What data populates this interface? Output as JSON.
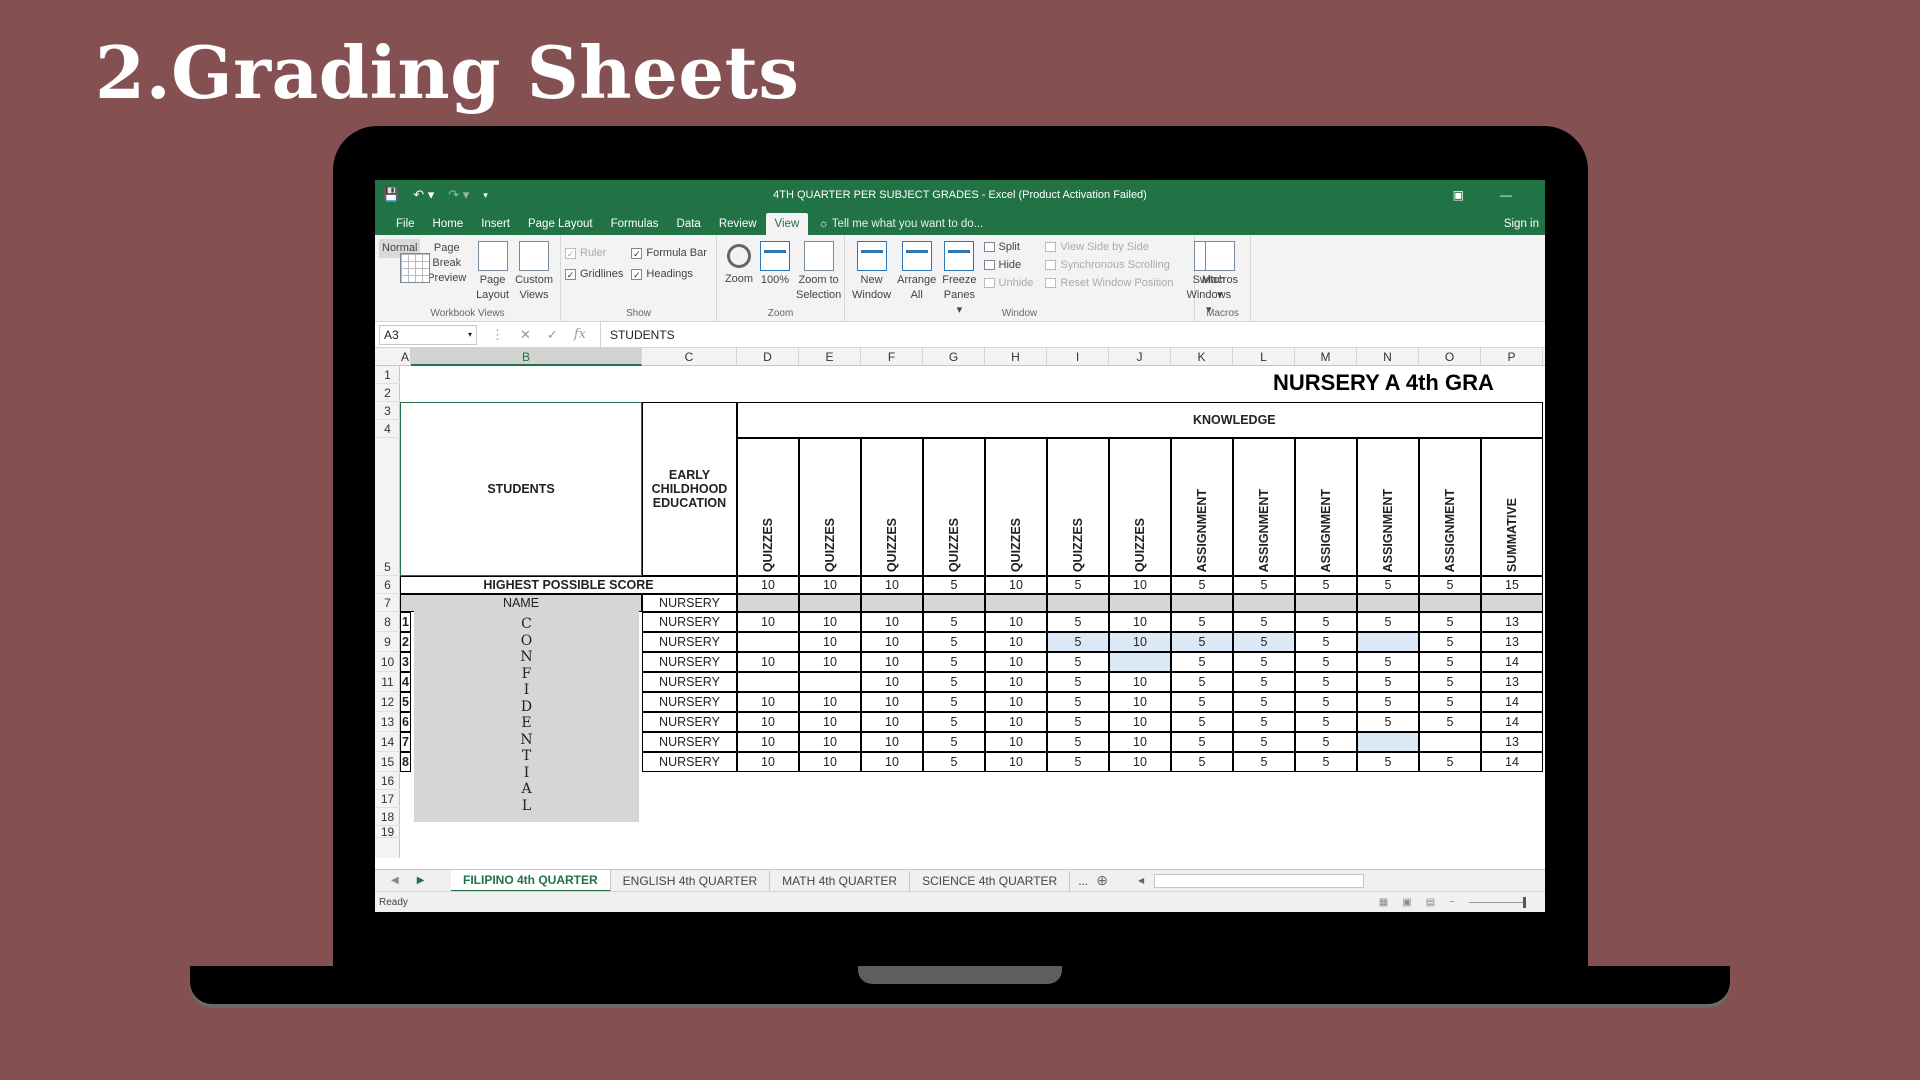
{
  "slide_title": "2.Grading Sheets",
  "excel": {
    "window_title": "4TH QUARTER PER SUBJECT GRADES - Excel (Product Activation Failed)",
    "menu_tabs": [
      "File",
      "Home",
      "Insert",
      "Page Layout",
      "Formulas",
      "Data",
      "Review",
      "View"
    ],
    "active_menu_tab": "View",
    "tell_me": "Tell me what you want to do...",
    "sign_in": "Sign in",
    "ribbon": {
      "workbook_views": {
        "label": "Workbook Views",
        "buttons": [
          [
            "Normal",
            ""
          ],
          [
            "Page Break",
            "Preview"
          ],
          [
            "Page",
            "Layout"
          ],
          [
            "Custom",
            "Views"
          ]
        ]
      },
      "show": {
        "label": "Show",
        "ruler": "Ruler",
        "formula_bar": "Formula Bar",
        "gridlines": "Gridlines",
        "headings": "Headings"
      },
      "zoom": {
        "label": "Zoom",
        "buttons": [
          [
            "Zoom",
            ""
          ],
          [
            "100%",
            ""
          ],
          [
            "Zoom to",
            "Selection"
          ]
        ]
      },
      "window": {
        "label": "Window",
        "new_window": [
          "New",
          "Window"
        ],
        "arrange_all": [
          "Arrange",
          "All"
        ],
        "freeze_panes": [
          "Freeze",
          "Panes ▾"
        ],
        "split": "Split",
        "hide": "Hide",
        "unhide": "Unhide",
        "view_side_by_side": "View Side by Side",
        "synchronous_scrolling": "Synchronous Scrolling",
        "reset_window_position": "Reset Window Position",
        "switch_windows": [
          "Switch",
          "Windows ▾"
        ]
      },
      "macros": {
        "label": "Macros",
        "button": [
          "Macros",
          "▾"
        ]
      }
    },
    "name_box": "A3",
    "formula_value": "STUDENTS",
    "columns": [
      "A",
      "B",
      "C",
      "D",
      "E",
      "F",
      "G",
      "H",
      "I",
      "J",
      "K",
      "L",
      "M",
      "N",
      "O",
      "P"
    ],
    "rows": [
      "1",
      "2",
      "3",
      "4",
      "5",
      "6",
      "7",
      "8",
      "9",
      "10",
      "11",
      "12",
      "13",
      "14",
      "15",
      "16",
      "17",
      "18",
      "19"
    ],
    "sheet_title": "NURSERY A 4th GRA",
    "header": {
      "students": "STUDENTS",
      "early_childhood": "EARLY CHILDHOOD EDUCATION",
      "knowledge": "KNOWLEDGE",
      "highest_possible_score": "HIGHEST POSSIBLE SCORE",
      "name": "NAME",
      "nursery": "NURSERY",
      "categories": [
        "QUIZZES",
        "QUIZZES",
        "QUIZZES",
        "QUIZZES",
        "QUIZZES",
        "QUIZZES",
        "QUIZZES",
        "ASSIGNMENT",
        "ASSIGNMENT",
        "ASSIGNMENT",
        "ASSIGNMENT",
        "ASSIGNMENT",
        "SUMMATIVE"
      ],
      "highest_scores": [
        "10",
        "10",
        "10",
        "5",
        "10",
        "5",
        "10",
        "5",
        "5",
        "5",
        "5",
        "5",
        "15"
      ]
    },
    "confidential_letters": [
      "C",
      "O",
      "N",
      "F",
      "I",
      "D",
      "E",
      "N",
      "T",
      "I",
      "A",
      "L"
    ],
    "students": [
      {
        "no": "1",
        "section": "NURSERY",
        "scores": [
          "10",
          "10",
          "10",
          "5",
          "10",
          "5",
          "10",
          "5",
          "5",
          "5",
          "5",
          "5",
          "13"
        ]
      },
      {
        "no": "2",
        "section": "NURSERY",
        "scores": [
          "",
          "10",
          "10",
          "5",
          "10",
          "5",
          "10",
          "5",
          "5",
          "5",
          "",
          "5",
          "13"
        ]
      },
      {
        "no": "3",
        "section": "NURSERY",
        "scores": [
          "10",
          "10",
          "10",
          "5",
          "10",
          "5",
          "",
          "5",
          "5",
          "5",
          "5",
          "5",
          "14"
        ]
      },
      {
        "no": "4",
        "section": "NURSERY",
        "scores": [
          "",
          "",
          "10",
          "5",
          "10",
          "5",
          "10",
          "5",
          "5",
          "5",
          "5",
          "5",
          "13"
        ]
      },
      {
        "no": "5",
        "section": "NURSERY",
        "scores": [
          "10",
          "10",
          "10",
          "5",
          "10",
          "5",
          "10",
          "5",
          "5",
          "5",
          "5",
          "5",
          "14"
        ]
      },
      {
        "no": "6",
        "section": "NURSERY",
        "scores": [
          "10",
          "10",
          "10",
          "5",
          "10",
          "5",
          "10",
          "5",
          "5",
          "5",
          "5",
          "5",
          "14"
        ]
      },
      {
        "no": "7",
        "section": "NURSERY",
        "scores": [
          "10",
          "10",
          "10",
          "5",
          "10",
          "5",
          "10",
          "5",
          "5",
          "5",
          "",
          "",
          "13"
        ]
      },
      {
        "no": "8",
        "section": "NURSERY",
        "scores": [
          "10",
          "10",
          "10",
          "5",
          "10",
          "5",
          "10",
          "5",
          "5",
          "5",
          "5",
          "5",
          "14"
        ]
      }
    ],
    "sheet_tabs": [
      "FILIPINO 4th QUARTER",
      "ENGLISH 4th QUARTER",
      "MATH 4th QUARTER",
      "SCIENCE 4th QUARTER"
    ],
    "active_sheet_tab": "FILIPINO 4th QUARTER",
    "more_tabs": "...",
    "status": "Ready",
    "colors": {
      "excel_green": "#217346",
      "slide_bg": "#855052",
      "highlight_blue": "#dbe8f5",
      "gray_cell": "#d6d6d6"
    }
  }
}
